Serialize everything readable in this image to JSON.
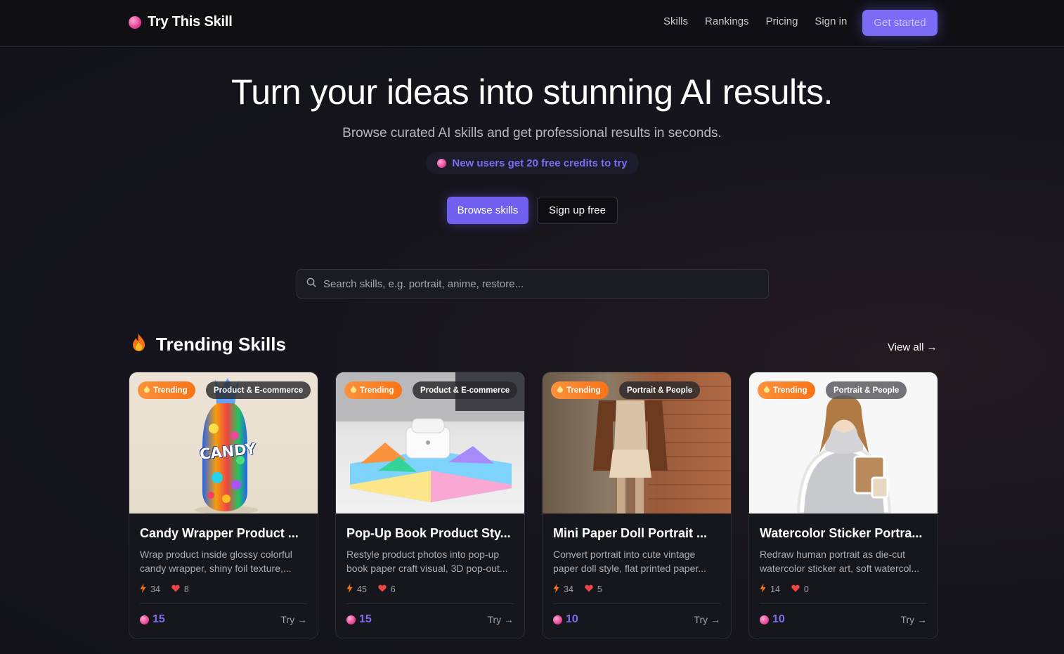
{
  "nav": {
    "logo_text": "Try This Skill",
    "links": [
      "Skills",
      "Rankings",
      "Pricing",
      "Sign in"
    ],
    "cta": "Get started"
  },
  "hero": {
    "title": "Turn your ideas into stunning AI results.",
    "subtitle": "Browse curated AI skills and get professional results in seconds.",
    "promo": "New users get 20 free credits to try",
    "primary_button": "Browse skills",
    "secondary_button": "Sign up free"
  },
  "search": {
    "placeholder": "Search skills, e.g. portrait, anime, restore..."
  },
  "section": {
    "title": "Trending Skills",
    "view_all": "View all →"
  },
  "cards": [
    {
      "badge": "Trending",
      "category": "Product & E-commerce",
      "title": "Candy Wrapper Product ...",
      "desc_line1": "Wrap product inside glossy colorful",
      "desc_line2": "candy wrapper, shiny foil texture,...",
      "uses": "34",
      "likes": "8",
      "credits": "15",
      "try": "Try →",
      "image_text": "CANDY"
    },
    {
      "badge": "Trending",
      "category": "Product & E-commerce",
      "title": "Pop-Up Book Product Sty...",
      "desc_line1": "Restyle product photos into pop-up",
      "desc_line2": "book paper craft visual, 3D pop-out...",
      "uses": "45",
      "likes": "6",
      "credits": "15",
      "try": "Try →"
    },
    {
      "badge": "Trending",
      "category": "Portrait & People",
      "title": "Mini Paper Doll Portrait ...",
      "desc_line1": "Convert portrait into cute vintage",
      "desc_line2": "paper doll style, flat printed paper...",
      "uses": "34",
      "likes": "5",
      "credits": "10",
      "try": "Try →"
    },
    {
      "badge": "Trending",
      "category": "Portrait & People",
      "title": "Watercolor Sticker Portra...",
      "desc_line1": "Redraw human portrait as die-cut",
      "desc_line2": "watercolor sticker art, soft watercol...",
      "uses": "14",
      "likes": "0",
      "credits": "10",
      "try": "Try →"
    }
  ],
  "colors": {
    "accent": "#7c6cf5",
    "trending_badge": "#f97316",
    "credit_dot": "#ec4899",
    "heart": "#ef4444",
    "bolt": "#f97316"
  }
}
